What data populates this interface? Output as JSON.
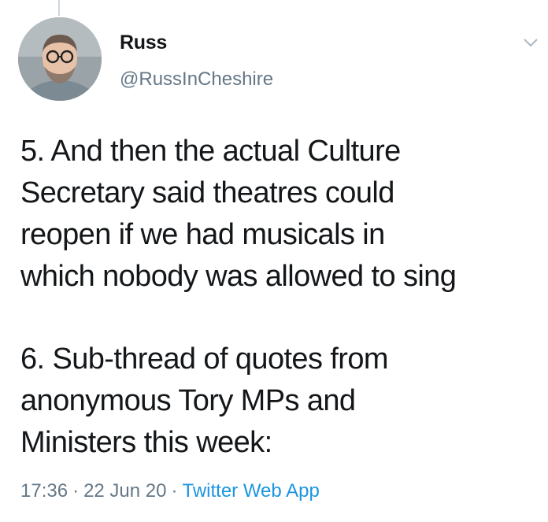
{
  "author": {
    "name": "Russ",
    "handle": "@RussInCheshire"
  },
  "tweet": {
    "paragraphs": [
      [
        "5. And then the actual Culture",
        "Secretary said theatres could",
        "reopen if we had musicals in",
        "which nobody was allowed to sing"
      ],
      [
        "6. Sub-thread of quotes from",
        "anonymous Tory MPs and",
        "Ministers this week:"
      ]
    ]
  },
  "meta": {
    "time": "17:36",
    "separator": "·",
    "date": "22 Jun 20",
    "source": "Twitter Web App"
  },
  "icons": {
    "menu": "chevron-down-icon"
  },
  "colors": {
    "text": "#14171a",
    "secondary": "#657786",
    "link": "#1b95e0"
  }
}
